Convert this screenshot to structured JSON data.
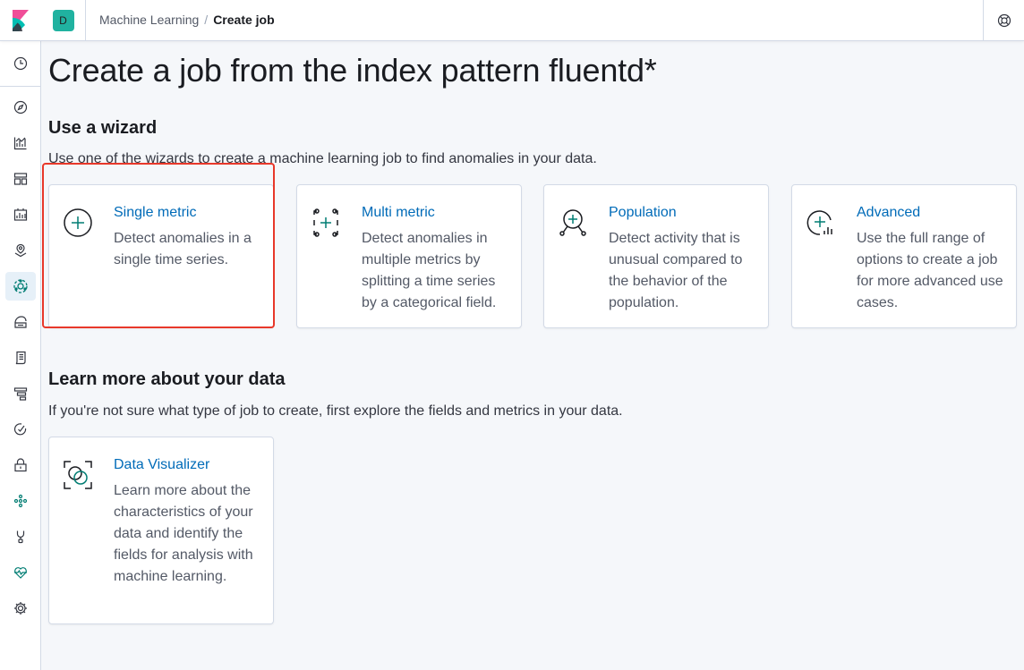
{
  "colors": {
    "accent_link": "#006bb8",
    "brand_teal": "#017d73",
    "space_badge": "#20b2a0",
    "highlight": "#e8382a"
  },
  "header": {
    "space_initial": "D",
    "breadcrumbs": [
      "Machine Learning",
      "Create job"
    ],
    "breadcrumb_separator": "/",
    "help_icon": "help-lifebuoy-icon"
  },
  "sidenav": {
    "items": [
      {
        "icon": "clock-icon"
      },
      {
        "icon": "compass-icon"
      },
      {
        "icon": "visualize-icon"
      },
      {
        "icon": "dashboard-icon"
      },
      {
        "icon": "canvas-icon"
      },
      {
        "icon": "maps-icon"
      },
      {
        "icon": "machine-learning-icon",
        "active": true
      },
      {
        "icon": "infrastructure-icon"
      },
      {
        "icon": "logs-icon"
      },
      {
        "icon": "apm-icon"
      },
      {
        "icon": "uptime-icon"
      },
      {
        "icon": "siem-icon"
      },
      {
        "icon": "graph-icon"
      },
      {
        "icon": "dev-tools-icon"
      },
      {
        "icon": "monitoring-icon"
      },
      {
        "icon": "gear-icon"
      }
    ]
  },
  "main": {
    "page_title": "Create a job from the index pattern fluentd*",
    "wizard_section": {
      "title": "Use a wizard",
      "description": "Use one of the wizards to create a machine learning job to find anomalies in your data.",
      "cards": [
        {
          "title": "Single metric",
          "description": "Detect anomalies in a single time series.",
          "icon": "single-metric-icon"
        },
        {
          "title": "Multi metric",
          "description": "Detect anomalies in multiple metrics by splitting a time series by a categorical field.",
          "icon": "multi-metric-icon"
        },
        {
          "title": "Population",
          "description": "Detect activity that is unusual compared to the behavior of the population.",
          "icon": "population-icon"
        },
        {
          "title": "Advanced",
          "description": "Use the full range of options to create a job for more advanced use cases.",
          "icon": "advanced-icon"
        }
      ]
    },
    "learn_section": {
      "title": "Learn more about your data",
      "description": "If you're not sure what type of job to create, first explore the fields and metrics in your data.",
      "cards": [
        {
          "title": "Data Visualizer",
          "description": "Learn more about the characteristics of your data and identify the fields for analysis with machine learning.",
          "icon": "data-visualizer-icon"
        }
      ]
    }
  }
}
